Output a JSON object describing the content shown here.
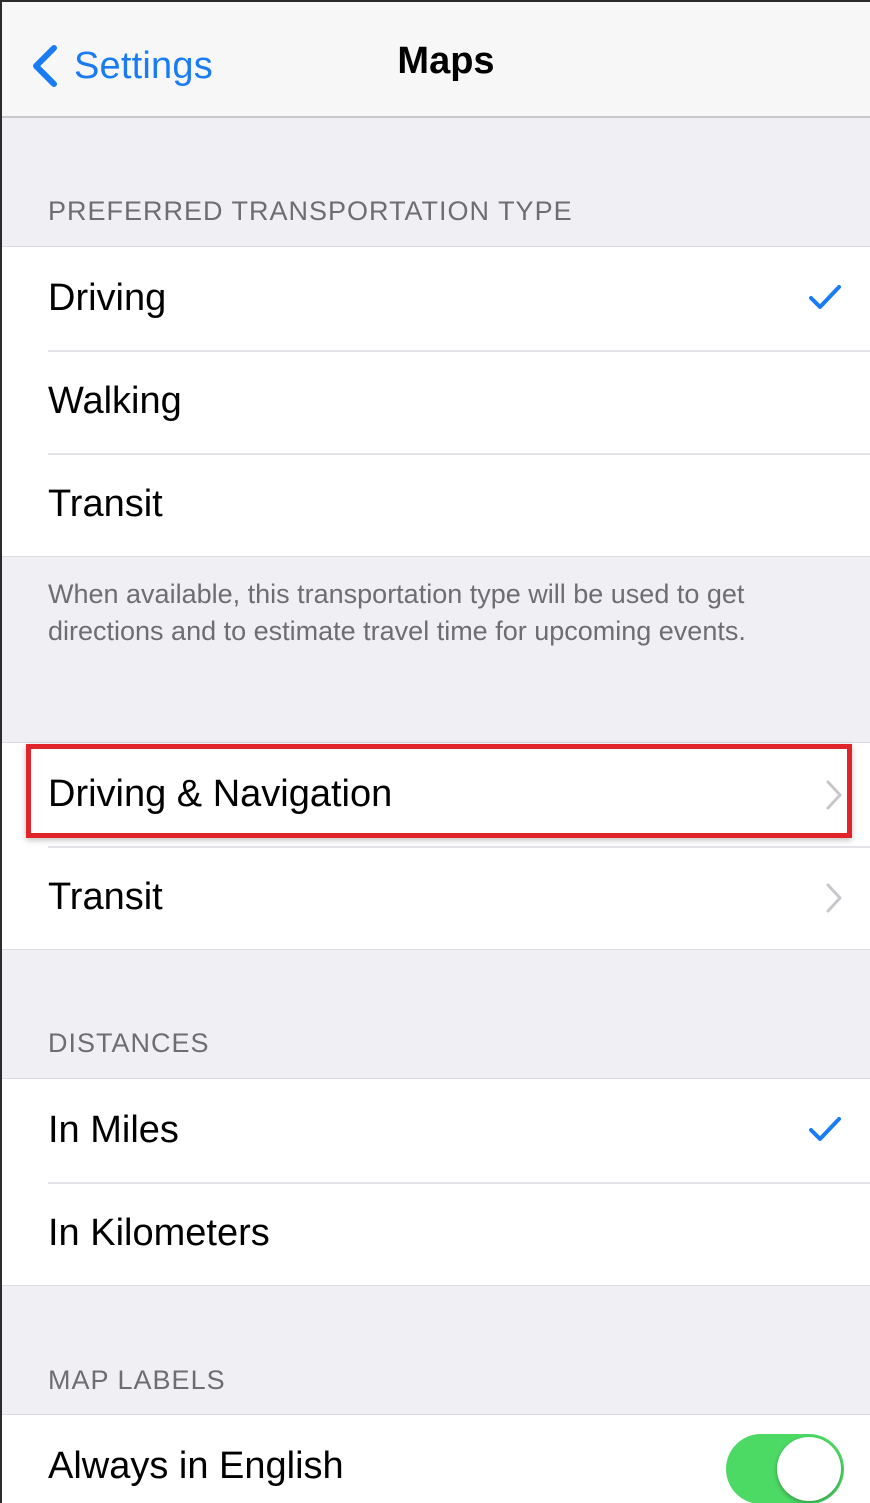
{
  "navbar": {
    "back_label": "Settings",
    "back_icon": "chevron-left-icon",
    "title": "Maps"
  },
  "transport": {
    "header": "PREFERRED TRANSPORTATION TYPE",
    "items": [
      {
        "label": "Driving",
        "selected": true
      },
      {
        "label": "Walking",
        "selected": false
      },
      {
        "label": "Transit",
        "selected": false
      }
    ],
    "footer": "When available, this transportation type will be used to get directions and to estimate travel time for upcoming events."
  },
  "nav_links": {
    "items": [
      {
        "label": "Driving & Navigation",
        "highlighted": true
      },
      {
        "label": "Transit",
        "highlighted": false
      }
    ]
  },
  "distances": {
    "header": "DISTANCES",
    "items": [
      {
        "label": "In Miles",
        "selected": true
      },
      {
        "label": "In Kilometers",
        "selected": false
      }
    ]
  },
  "map_labels": {
    "header": "MAP LABELS",
    "items": [
      {
        "label": "Always in English",
        "toggle_on": true
      }
    ]
  },
  "colors": {
    "accent": "#1a7cf5",
    "toggle_on": "#4cd964",
    "highlight": "#e0242a",
    "background": "#efeff4"
  }
}
